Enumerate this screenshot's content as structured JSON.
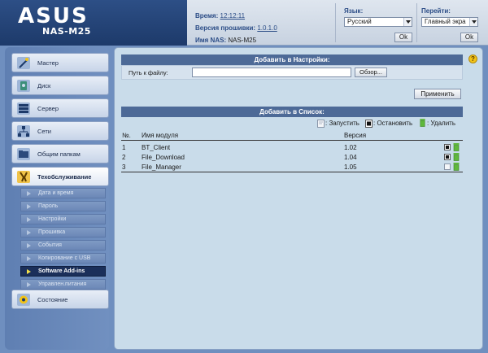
{
  "header": {
    "model": "NAS-M25",
    "time_label": "Время:",
    "time_value": "12:12:11",
    "firmware_label": "Версия прошивки:",
    "firmware_value": "1.0.1.0",
    "nas_name_label": "Имя NAS:",
    "nas_name_value": "NAS-M25",
    "language_label": "Язык:",
    "language_value": "Русский",
    "language_ok": "Ok",
    "goto_label": "Перейти:",
    "goto_value": "Главный экра",
    "goto_ok": "Ok"
  },
  "sidebar": {
    "items": [
      {
        "label": "Мастер",
        "icon": "wand-icon"
      },
      {
        "label": "Диск",
        "icon": "disk-icon"
      },
      {
        "label": "Сервер",
        "icon": "server-icon"
      },
      {
        "label": "Сети",
        "icon": "network-icon"
      },
      {
        "label": "Общим папкам",
        "icon": "folder-icon"
      },
      {
        "label": "Техобслуживание",
        "icon": "tools-icon"
      },
      {
        "label": "Состояние",
        "icon": "status-icon"
      }
    ],
    "subitems": [
      {
        "label": "Дата и время"
      },
      {
        "label": "Пароль"
      },
      {
        "label": "Настройки"
      },
      {
        "label": "Прошивка"
      },
      {
        "label": "События"
      },
      {
        "label": "Копирование с USB"
      },
      {
        "label": "Software Add-ins"
      },
      {
        "label": "Управлен.питания"
      }
    ],
    "active_item": "Техобслуживание",
    "active_subitem": "Software Add-ins"
  },
  "main": {
    "add_settings_title": "Добавить в Настройки:",
    "file_path_label": "Путь к файлу:",
    "file_path_value": "",
    "browse_button": "Обзор...",
    "apply_button": "Применить",
    "add_list_title": "Добавить в Список:",
    "legend": {
      "start": ": Запустить",
      "stop": ": Остановить",
      "delete": ": Удалить"
    },
    "table": {
      "headers": [
        "№.",
        "Имя модуля",
        "Версия"
      ],
      "rows": [
        {
          "no": "1",
          "name": "BT_Client",
          "version": "1.02",
          "state": "running"
        },
        {
          "no": "2",
          "name": "File_Download",
          "version": "1.04",
          "state": "running"
        },
        {
          "no": "3",
          "name": "File_Manager",
          "version": "1.05",
          "state": "stopped"
        }
      ]
    }
  },
  "colors": {
    "accent_blue": "#4d6a97",
    "header_logo_bg": "#1d3a6a",
    "sidebar_bg": "#6f8fbf",
    "main_bg": "#c9dcea",
    "help_icon": "#f2c318",
    "delete_icon": "#5fb83c"
  }
}
